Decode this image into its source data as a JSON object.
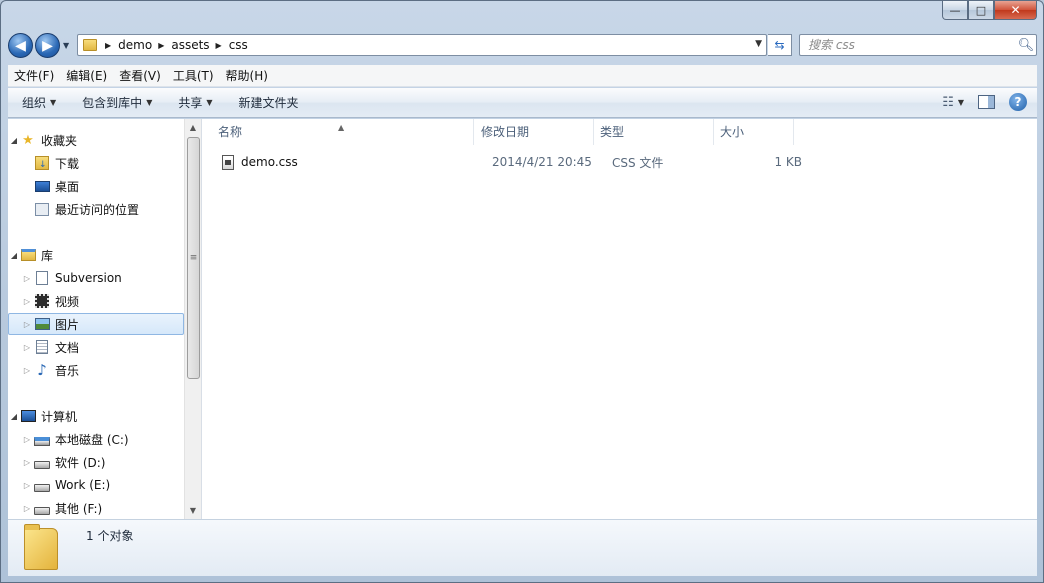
{
  "window": {
    "caption": {
      "minimize": "—",
      "maximize": "□",
      "close": "✕"
    }
  },
  "nav": {
    "back_glyph": "◀",
    "forward_glyph": "▶",
    "breadcrumbs": [
      "demo",
      "assets",
      "css"
    ],
    "search_placeholder": "搜索 css"
  },
  "menu": [
    "文件(F)",
    "编辑(E)",
    "查看(V)",
    "工具(T)",
    "帮助(H)"
  ],
  "commands": {
    "organize": "组织",
    "include_in_library": "包含到库中",
    "share": "共享",
    "new_folder": "新建文件夹"
  },
  "sidebar": {
    "favorites": {
      "label": "收藏夹",
      "items": [
        "下载",
        "桌面",
        "最近访问的位置"
      ]
    },
    "libraries": {
      "label": "库",
      "items": [
        "Subversion",
        "视频",
        "图片",
        "文档",
        "音乐"
      ],
      "selected": "图片"
    },
    "computer": {
      "label": "计算机",
      "items": [
        "本地磁盘 (C:)",
        "软件 (D:)",
        "Work (E:)",
        "其他 (F:)"
      ]
    }
  },
  "columns": {
    "name": "名称",
    "date": "修改日期",
    "type": "类型",
    "size": "大小"
  },
  "files": [
    {
      "name": "demo.css",
      "date": "2014/4/21 20:45",
      "type": "CSS 文件",
      "size": "1 KB"
    }
  ],
  "details": {
    "count": "1 个对象"
  },
  "colors": {
    "accent": "#2a68b5",
    "selection": "#d6e8fa",
    "close": "#c0381c"
  }
}
